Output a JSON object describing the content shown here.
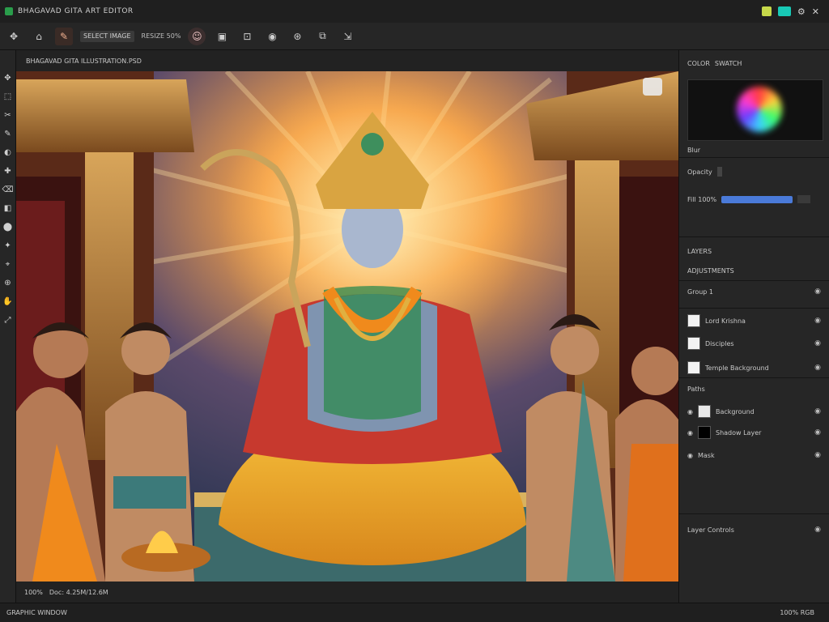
{
  "app": {
    "title": "BHAGAVAD GITA ART EDITOR"
  },
  "window_controls": [
    {
      "name": "window-swatch-yellow",
      "color": "#c6d84a"
    },
    {
      "name": "window-swatch-teal",
      "color": "#18c9b6"
    },
    {
      "name": "window-settings-icon",
      "glyph": "⚙"
    },
    {
      "name": "window-close-icon",
      "glyph": "✕"
    }
  ],
  "toolbar": {
    "items": [
      {
        "kind": "button",
        "name": "move-tool-icon",
        "glyph": "✥"
      },
      {
        "kind": "button",
        "name": "home-icon",
        "glyph": "⌂"
      },
      {
        "kind": "button",
        "name": "brush-icon",
        "glyph": "✎"
      },
      {
        "kind": "field",
        "name": "file-name-field",
        "label": "SELECT IMAGE"
      },
      {
        "kind": "text",
        "name": "zoom-label",
        "label": "RESIZE 50%"
      },
      {
        "kind": "button",
        "name": "user-icon",
        "glyph": "☺"
      },
      {
        "kind": "button",
        "name": "image-icon",
        "glyph": "▣"
      },
      {
        "kind": "button",
        "name": "crop-icon",
        "glyph": "⊡"
      },
      {
        "kind": "button",
        "name": "camera-icon",
        "glyph": "◉"
      },
      {
        "kind": "button",
        "name": "filter-icon",
        "glyph": "⊛"
      },
      {
        "kind": "button",
        "name": "layers-icon",
        "glyph": "⧉"
      },
      {
        "kind": "button",
        "name": "transform-icon",
        "glyph": "⇲"
      }
    ]
  },
  "tools": [
    "✥",
    "⬚",
    "✂",
    "✎",
    "◐",
    "✚",
    "⌫",
    "◧",
    "⬤",
    "✦",
    "⌖",
    "⊕",
    "✋",
    "⤢"
  ],
  "tool_names": [
    "move-tool-icon",
    "marquee-tool-icon",
    "crop-tool-icon",
    "pen-tool-icon",
    "dodge-tool-icon",
    "healing-tool-icon",
    "eraser-tool-icon",
    "gradient-tool-icon",
    "fill-tool-icon",
    "shape-tool-icon",
    "select-tool-icon",
    "zoom-tool-icon",
    "hand-tool-icon",
    "rotate-tool-icon"
  ],
  "document": {
    "tab_title": "BHAGAVAD GITA ILLUSTRATION.PSD",
    "zoom": "100%",
    "info": "Doc: 4.25M/12.6M"
  },
  "statusbar": {
    "left": "GRAPHIC WINDOW",
    "right": "100%  RGB"
  },
  "panel": {
    "tabs": [
      "COLOR",
      "SWATCH"
    ],
    "label_blend": "Blur",
    "opacity_label": "Opacity",
    "fill_label": "Fill 100%",
    "layers_title": "LAYERS",
    "adjustments_title": "ADJUSTMENTS",
    "groups": [
      {
        "label": "Group 1"
      },
      {
        "label": "Lord Krishna"
      },
      {
        "label": "Disciples"
      },
      {
        "label": "Temple Background"
      }
    ],
    "sub_title": "Paths",
    "extra_rows": [
      {
        "label": "Background",
        "swatch": "#e8e8e8"
      },
      {
        "label": "Shadow Layer",
        "swatch": "#000000"
      },
      {
        "label": "Mask"
      }
    ],
    "bottom_label": "Layer Controls"
  }
}
